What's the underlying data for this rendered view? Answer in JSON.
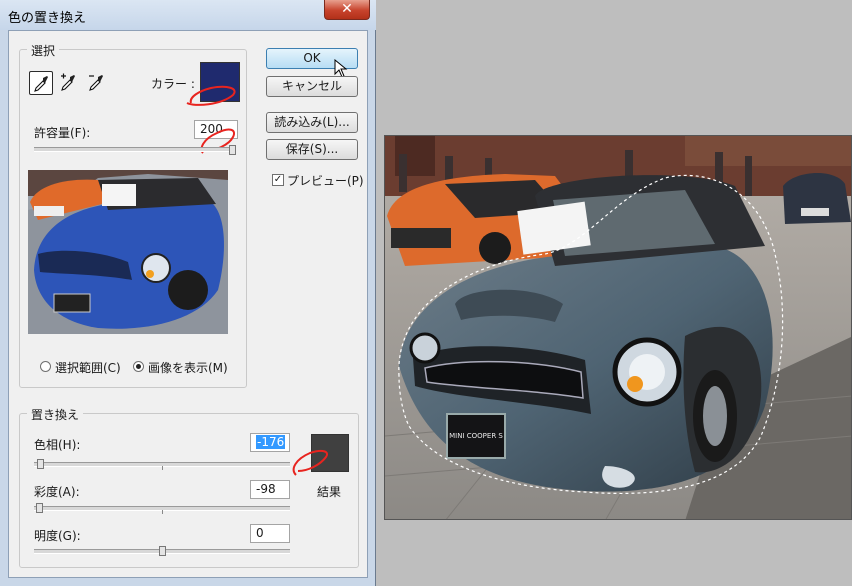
{
  "window": {
    "title": "色の置き換え",
    "close_glyph": "✕"
  },
  "selection_group": {
    "label": "選択",
    "tools": [
      "eyedropper-icon",
      "eyedropper-plus-icon",
      "eyedropper-minus-icon"
    ],
    "color_label": "カラー :",
    "color_swatch": "#1f2a6e",
    "tolerance_label": "許容量(F):",
    "tolerance_value": "200",
    "tolerance_level": 1.0,
    "radio_selection": "選択範囲(C)",
    "radio_image": "画像を表示(M)",
    "selected_radio": "image"
  },
  "buttons": {
    "ok": "OK",
    "cancel": "キャンセル",
    "load": "読み込み(L)...",
    "save": "保存(S)..."
  },
  "preview_check": {
    "label": "プレビュー(P)",
    "checked": true
  },
  "replacement_group": {
    "label": "置き換え",
    "hue_label": "色相(H):",
    "hue_value": "-176",
    "hue_level": 0.011,
    "saturation_label": "彩度(A):",
    "saturation_value": "-98",
    "saturation_level": 0.01,
    "lightness_label": "明度(G):",
    "lightness_value": "0",
    "lightness_level": 0.5,
    "result_label": "結果",
    "result_swatch": "#404040"
  },
  "photo": {
    "plate_text": "MINI COOPER S"
  },
  "colors": {
    "accent": "#3399ff",
    "annotation": "#e8241f"
  }
}
